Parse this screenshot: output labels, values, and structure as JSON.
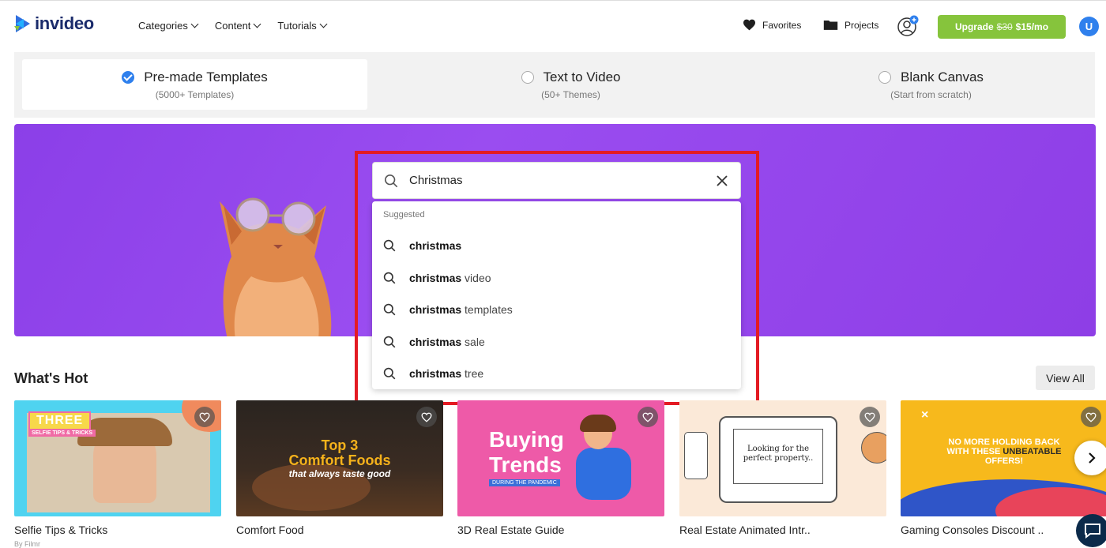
{
  "brand": {
    "name": "invideo"
  },
  "nav": {
    "items": [
      {
        "label": "Categories"
      },
      {
        "label": "Content"
      },
      {
        "label": "Tutorials"
      }
    ]
  },
  "header": {
    "favorites": "Favorites",
    "projects": "Projects",
    "upgrade_label": "Upgrade",
    "upgrade_old_price": "$30",
    "upgrade_price": "$15/mo",
    "avatar_initial": "U"
  },
  "modes": [
    {
      "title": "Pre-made Templates",
      "subtitle": "(5000+ Templates)",
      "selected": true
    },
    {
      "title": "Text to Video",
      "subtitle": "(50+ Themes)",
      "selected": false
    },
    {
      "title": "Blank Canvas",
      "subtitle": "(Start from scratch)",
      "selected": false
    }
  ],
  "search": {
    "value": "Christmas",
    "suggested_label": "Suggested"
  },
  "suggestions": [
    {
      "bold": "christmas",
      "rest": ""
    },
    {
      "bold": "christmas",
      "rest": " video"
    },
    {
      "bold": "christmas",
      "rest": " templates"
    },
    {
      "bold": "christmas",
      "rest": " sale"
    },
    {
      "bold": "christmas",
      "rest": " tree"
    }
  ],
  "whats_hot": {
    "title": "What's Hot",
    "view_all": "View All",
    "cards": [
      {
        "title": "Selfie Tips & Tricks",
        "thumb_text_1": "THREE",
        "thumb_text_2": "SELFIE TIPS & TRICKS"
      },
      {
        "title": "Comfort Food",
        "thumb_text_1": "Top 3",
        "thumb_text_2": "Comfort Foods",
        "thumb_text_3": "that always taste good"
      },
      {
        "title": "3D Real Estate Guide",
        "thumb_text_1": "Buying",
        "thumb_text_2": "Trends",
        "thumb_text_3": "DURING THE PANDEMIC"
      },
      {
        "title": "Real Estate Animated Intr..",
        "thumb_text_1": "Looking for the",
        "thumb_text_2": "perfect property.."
      },
      {
        "title": "Gaming Consoles Discount ..",
        "thumb_text_1": "NO MORE HOLDING BACK",
        "thumb_text_2": "WITH THESE",
        "thumb_text_3": "UNBEATABLE",
        "thumb_text_4": "OFFERS!"
      }
    ],
    "first_card_subtitle_cut": "By Filmr"
  },
  "colors": {
    "upgrade": "#86c43c",
    "hero": "#8b3fe8",
    "highlight": "#e31b23",
    "accent": "#2f80ed"
  }
}
